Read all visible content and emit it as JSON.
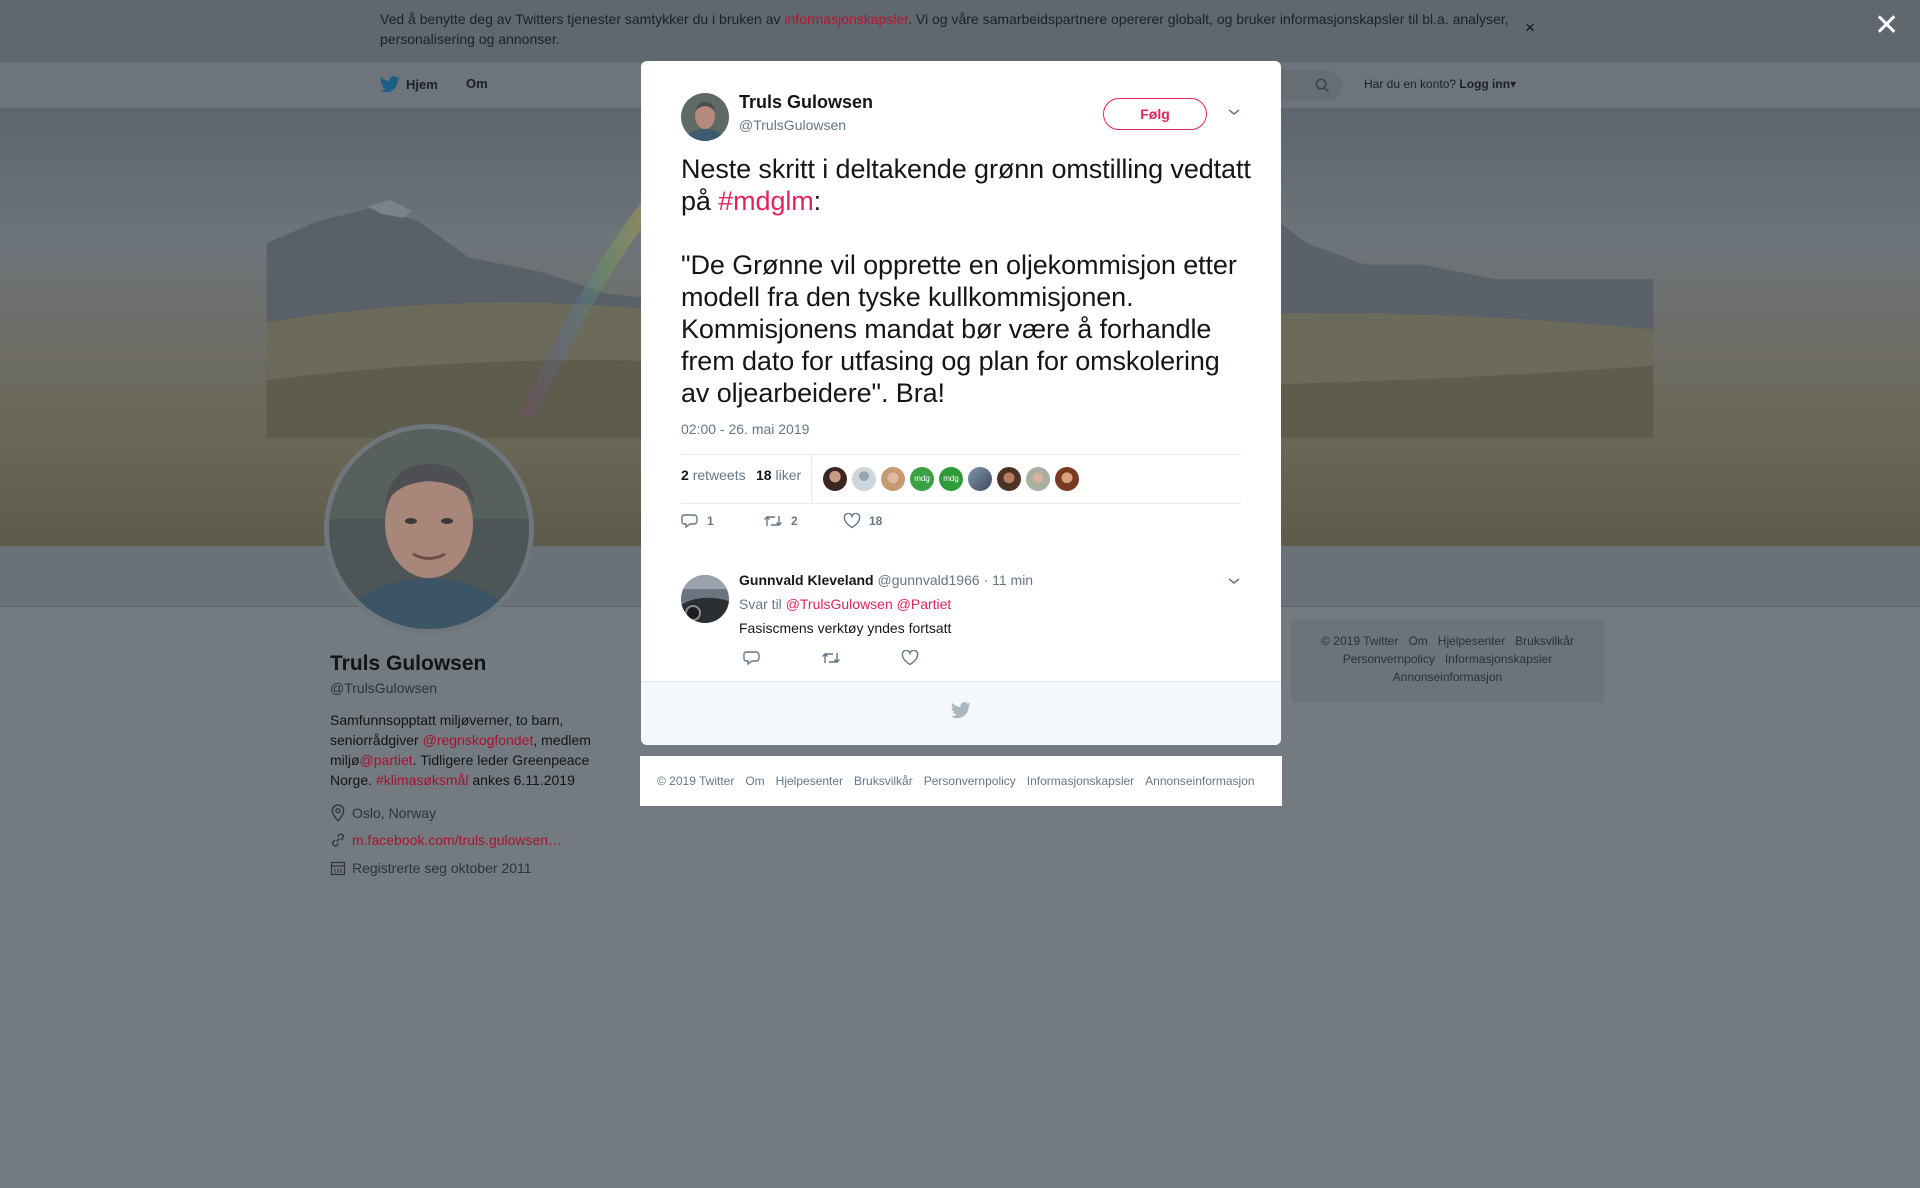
{
  "cookie_banner": {
    "text_before": "Ved å benytte deg av Twitters tjenester samtykker du i bruken av ",
    "link": "informasjonskapsler",
    "text_after": ". Vi og våre samarbeidspartnere opererer globalt, og bruker informasjonskapsler til bl.a. analyser, personalisering og annonser.",
    "close": "×"
  },
  "overlay_close": "✕",
  "nav": {
    "home": "Hjem",
    "about": "Om",
    "login_prompt": "Har du en konto?",
    "login": "Logg inn"
  },
  "profile": {
    "name": "Truls Gulowsen",
    "handle": "@TrulsGulowsen",
    "bio_1": "Samfunnsopptatt miljøverner, to barn, seniorrådgiver ",
    "bio_mention_1": "@regnskogfondet",
    "bio_2": ", medlem miljø",
    "bio_mention_2": "@partiet",
    "bio_3": ". Tidligere leder Greenpeace Norge. ",
    "bio_hashtag": "#klimasøksmål",
    "bio_4": " ankes 6.11.2019",
    "location": "Oslo, Norway",
    "website": "m.facebook.com/truls.gulowsen…",
    "joined": "Registrerte seg oktober 2011"
  },
  "side_footer": {
    "row1": [
      "© 2019 Twitter",
      "Om",
      "Hjelpesenter",
      "Bruksvilkår"
    ],
    "row2": [
      "Personvernpolicy",
      "Informasjonskapsler"
    ],
    "row3": [
      "Annonseinformasjon"
    ]
  },
  "tweet": {
    "author_name": "Truls Gulowsen",
    "author_handle": "@TrulsGulowsen",
    "follow": "Følg",
    "text_1": "Neste skritt i deltakende grønn omstilling vedtatt på ",
    "hashtag": "#mdglm",
    "text_2": ":\n\n\"De Grønne vil opprette en oljekommisjon etter modell fra den tyske kullkommisjonen. Kommisjonens mandat bør være å forhandle frem dato for utfasing og plan for omskolering av oljearbeidere\". Bra!",
    "time": "02:00 - 26. mai 2019",
    "retweets_count": "2",
    "retweets_label": "retweets",
    "likes_count": "18",
    "likes_label": "liker",
    "reply_count": "1",
    "retweet_action_count": "2",
    "like_action_count": "18"
  },
  "reply": {
    "name": "Gunnvald Kleveland",
    "handle": "@gunnvald1966",
    "time": "· 11 min",
    "reply_to_label": "Svar til",
    "reply_to_1": "@TrulsGulowsen",
    "reply_to_2": "@Partiet",
    "text": "Fasiscmens verktøy yndes fortsatt"
  },
  "modal_footer": [
    "© 2019 Twitter",
    "Om",
    "Hjelpesenter",
    "Bruksvilkår",
    "Personvernpolicy",
    "Informasjonskapsler",
    "Annonseinformasjon"
  ],
  "colors": {
    "accent": "#e0245e",
    "overlay": "#737a80",
    "text": "#14171a",
    "muted": "#657786"
  }
}
